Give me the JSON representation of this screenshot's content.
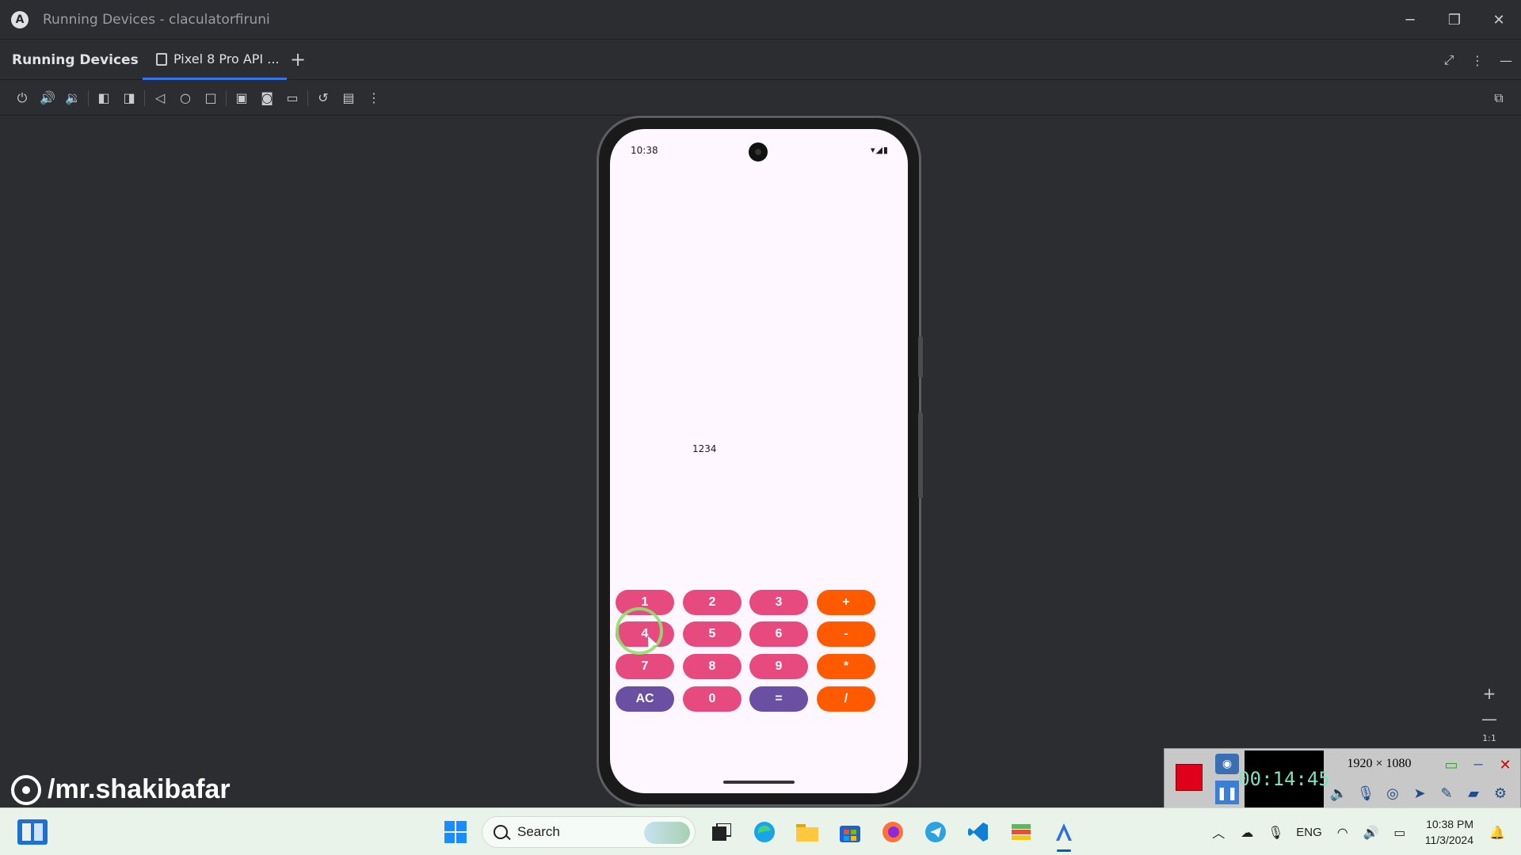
{
  "window": {
    "app_logo": "A",
    "title": "Running Devices - claculatorfiruni",
    "minimize": "─",
    "restore": "❐",
    "close": "✕"
  },
  "tool_window": {
    "title": "Running Devices",
    "tab_label": "Pixel 8 Pro API ...",
    "add_tab": "+",
    "header_icons": [
      "restore-layout-icon",
      "more-options-icon",
      "hide-icon"
    ]
  },
  "toolbar": {
    "icons": [
      "power-icon",
      "volume-up-icon",
      "volume-down-icon",
      "rotate-left-icon",
      "rotate-right-icon",
      "back-icon",
      "home-icon",
      "overview-icon",
      "device-manager-icon",
      "screenshot-icon",
      "screen-record-icon",
      "reset-icon",
      "snapshot-icon",
      "more-icon"
    ],
    "right_icon": "device-mirroring-icon"
  },
  "device": {
    "status_time": "10:38",
    "status_icons": "▾◢▮",
    "display_value": "1234",
    "keys": [
      {
        "label": "1",
        "style": "pink"
      },
      {
        "label": "2",
        "style": "pink"
      },
      {
        "label": "3",
        "style": "pink"
      },
      {
        "label": "+",
        "style": "orange"
      },
      {
        "label": "4",
        "style": "pink"
      },
      {
        "label": "5",
        "style": "pink"
      },
      {
        "label": "6",
        "style": "pink"
      },
      {
        "label": "-",
        "style": "orange"
      },
      {
        "label": "7",
        "style": "pink"
      },
      {
        "label": "8",
        "style": "pink"
      },
      {
        "label": "9",
        "style": "pink"
      },
      {
        "label": "*",
        "style": "orange"
      },
      {
        "label": "AC",
        "style": "purple"
      },
      {
        "label": "0",
        "style": "pink"
      },
      {
        "label": "=",
        "style": "purple"
      },
      {
        "label": "/",
        "style": "orange"
      }
    ],
    "colors": {
      "pink": "#e64a7e",
      "orange": "#ff5a00",
      "purple": "#6a4fa3"
    }
  },
  "zoom": {
    "zoom_in": "+",
    "zoom_out": "—",
    "actual_size": "1:1"
  },
  "watermark": {
    "text": "/mr.shakibafar"
  },
  "recorder": {
    "timer": "00:14:45",
    "resolution": "1920 × 1080"
  },
  "taskbar": {
    "search_label": "Search",
    "apps": [
      "task-view-icon",
      "edge-icon",
      "file-explorer-icon",
      "store-icon",
      "firefox-icon",
      "telegram-icon",
      "vscode-icon",
      "bluestacks-icon",
      "android-studio-icon"
    ],
    "language": "ENG",
    "time": "10:38 PM",
    "date": "11/3/2024"
  }
}
